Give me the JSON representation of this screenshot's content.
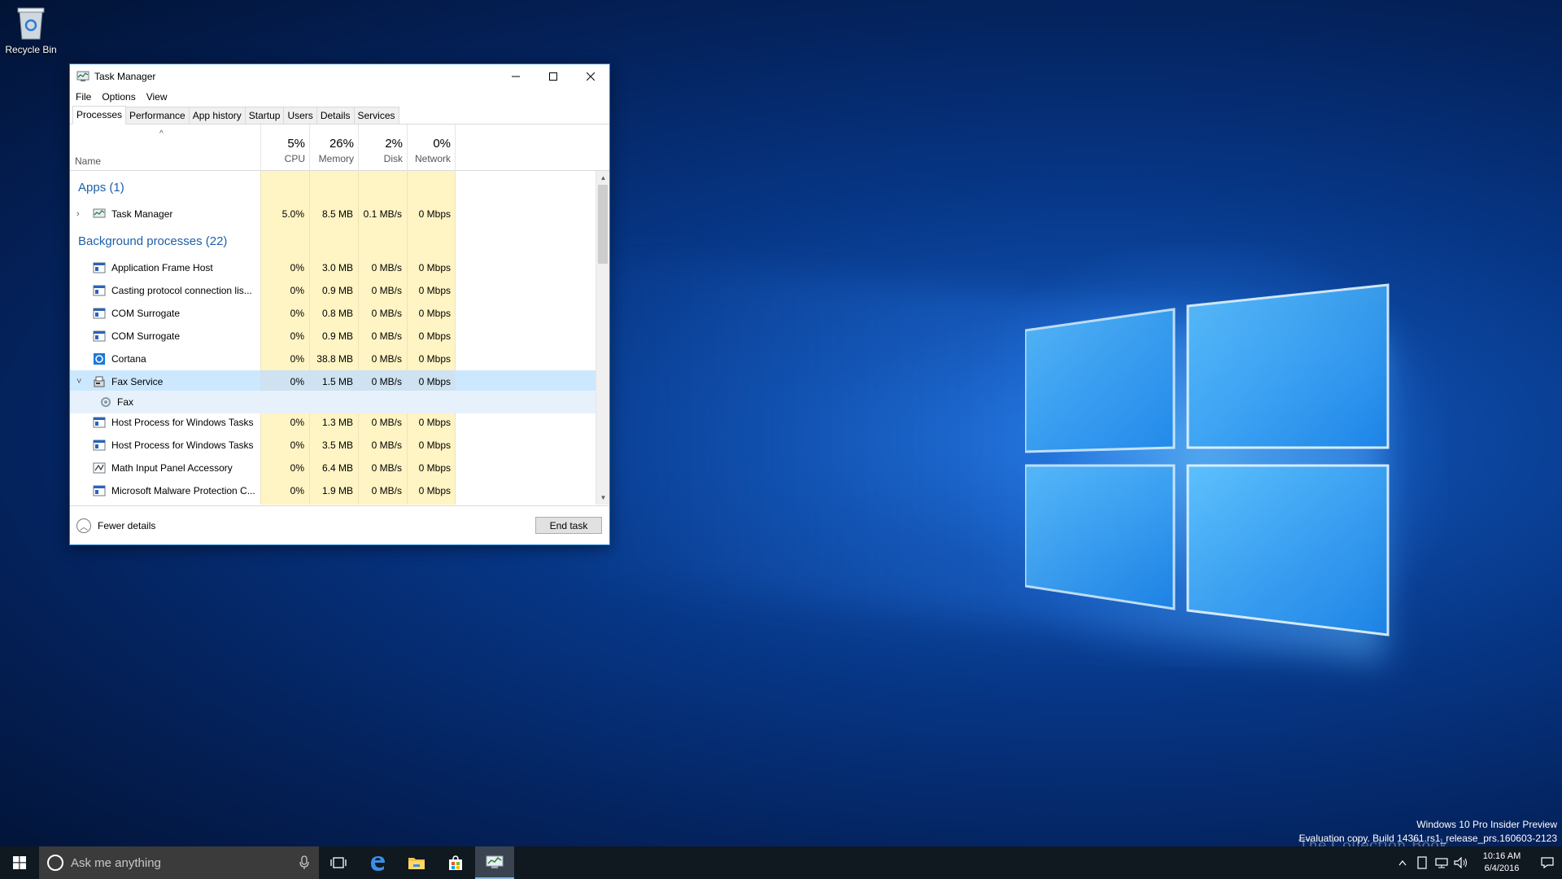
{
  "desktop": {
    "icons": [
      {
        "label": "Recycle Bin",
        "icon": "recycle-bin-icon"
      }
    ]
  },
  "window": {
    "title": "Task Manager",
    "menu": [
      "File",
      "Options",
      "View"
    ],
    "tabs": [
      "Processes",
      "Performance",
      "App history",
      "Startup",
      "Users",
      "Details",
      "Services"
    ],
    "active_tab": "Processes",
    "columns": {
      "name": "Name",
      "cpu": {
        "pct": "5%",
        "label": "CPU"
      },
      "memory": {
        "pct": "26%",
        "label": "Memory"
      },
      "disk": {
        "pct": "2%",
        "label": "Disk"
      },
      "network": {
        "pct": "0%",
        "label": "Network"
      }
    },
    "groups": {
      "apps": "Apps (1)",
      "background": "Background processes (22)"
    },
    "apps": [
      {
        "name": "Task Manager",
        "cpu": "5.0%",
        "memory": "8.5 MB",
        "disk": "0.1 MB/s",
        "network": "0 Mbps",
        "icon": "task-manager-icon",
        "expander": "›"
      }
    ],
    "background": [
      {
        "name": "Application Frame Host",
        "cpu": "0%",
        "memory": "3.0 MB",
        "disk": "0 MB/s",
        "network": "0 Mbps",
        "icon": "service-window-icon"
      },
      {
        "name": "Casting protocol connection lis...",
        "cpu": "0%",
        "memory": "0.9 MB",
        "disk": "0 MB/s",
        "network": "0 Mbps",
        "icon": "service-window-icon"
      },
      {
        "name": "COM Surrogate",
        "cpu": "0%",
        "memory": "0.8 MB",
        "disk": "0 MB/s",
        "network": "0 Mbps",
        "icon": "service-window-icon"
      },
      {
        "name": "COM Surrogate",
        "cpu": "0%",
        "memory": "0.9 MB",
        "disk": "0 MB/s",
        "network": "0 Mbps",
        "icon": "service-window-icon"
      },
      {
        "name": "Cortana",
        "cpu": "0%",
        "memory": "38.8 MB",
        "disk": "0 MB/s",
        "network": "0 Mbps",
        "icon": "cortana-icon"
      },
      {
        "name": "Fax Service",
        "cpu": "0%",
        "memory": "1.5 MB",
        "disk": "0 MB/s",
        "network": "0 Mbps",
        "icon": "fax-icon",
        "expanded": true
      },
      {
        "name": "Fax",
        "cpu": "",
        "memory": "",
        "disk": "",
        "network": "",
        "icon": "gear-icon",
        "child": true
      },
      {
        "name": "Host Process for Windows Tasks",
        "cpu": "0%",
        "memory": "1.3 MB",
        "disk": "0 MB/s",
        "network": "0 Mbps",
        "icon": "service-window-icon"
      },
      {
        "name": "Host Process for Windows Tasks",
        "cpu": "0%",
        "memory": "3.5 MB",
        "disk": "0 MB/s",
        "network": "0 Mbps",
        "icon": "service-window-icon"
      },
      {
        "name": "Math Input Panel Accessory",
        "cpu": "0%",
        "memory": "6.4 MB",
        "disk": "0 MB/s",
        "network": "0 Mbps",
        "icon": "math-input-icon"
      },
      {
        "name": "Microsoft Malware Protection C...",
        "cpu": "0%",
        "memory": "1.9 MB",
        "disk": "0 MB/s",
        "network": "0 Mbps",
        "icon": "service-window-icon"
      }
    ],
    "footer": {
      "fewer_details": "Fewer details",
      "end_task": "End task"
    }
  },
  "evaluation": {
    "line1": "Windows 10 Pro Insider Preview",
    "line2": "Evaluation copy. Build 14361.rs1_release_prs.160603-2123"
  },
  "watermark": "The Collection Book",
  "taskbar": {
    "search_placeholder": "Ask me anything",
    "time": "10:16 AM",
    "date": "6/4/2016",
    "pinned": [
      "task-view-icon",
      "edge-icon",
      "file-explorer-icon",
      "store-icon",
      "task-manager-icon"
    ]
  },
  "colors": {
    "accent": "#1683d8",
    "group_title": "#1e5fa8",
    "heat_cell": "#fff4c4",
    "selected_row": "#cce8ff",
    "taskbar": "#101820"
  }
}
